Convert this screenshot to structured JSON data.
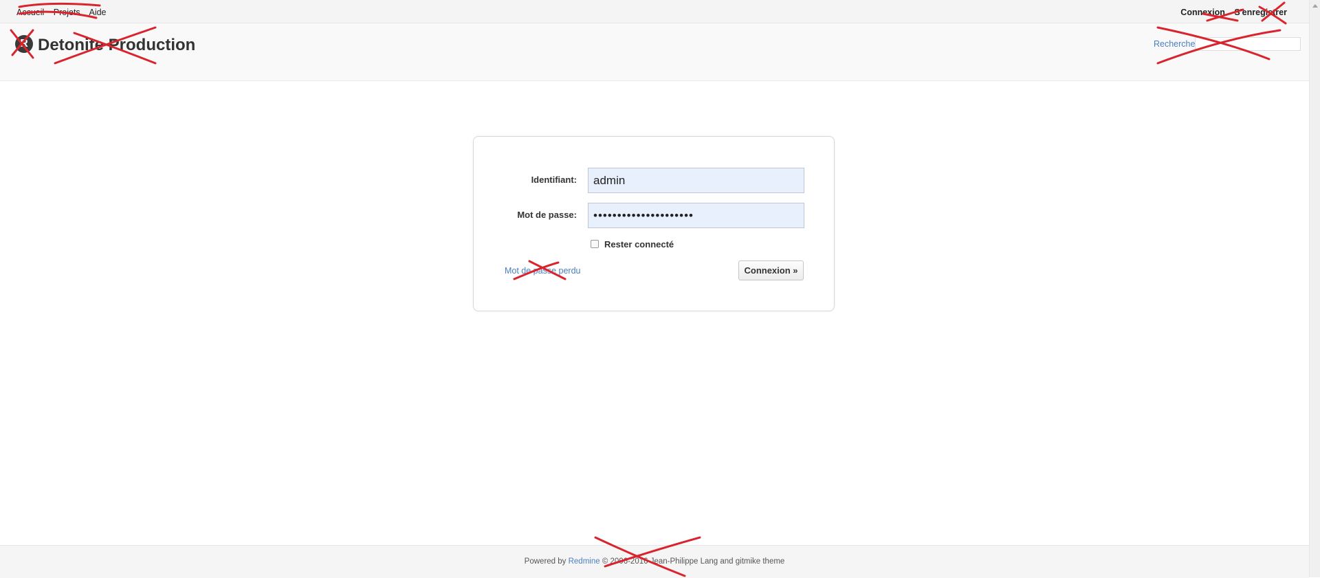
{
  "top_menu": {
    "left_items": [
      "Accueil",
      "Projets",
      "Aide"
    ],
    "login": "Connexion",
    "register": "S'enregistrer"
  },
  "header": {
    "logo_glyph": "R",
    "title": "Detonite Production",
    "search_label": "Recherche",
    "search_value": ""
  },
  "login_form": {
    "username_label": "Identifiant:",
    "username_value": "admin",
    "password_label": "Mot de passe:",
    "password_value": "•••••••••••••••••••••",
    "remember_label": "Rester connecté",
    "remember_checked": false,
    "lost_password": "Mot de passe perdu",
    "submit_label": "Connexion »"
  },
  "footer": {
    "powered_by": "Powered by",
    "redmine_link": "Redmine",
    "copyright": "© 2006-2016 Jean-Philippe Lang and gitmike theme"
  },
  "colors": {
    "link": "#4a7fc1",
    "redaction": "#d9232d",
    "autofill": "#e8f0fe"
  }
}
